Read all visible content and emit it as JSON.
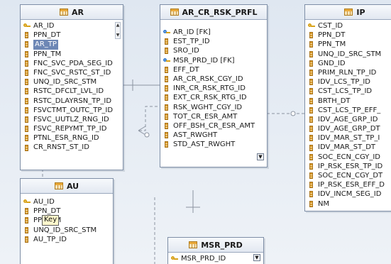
{
  "entities": {
    "ar": {
      "name": "AR",
      "columns": [
        {
          "label": "AR_ID",
          "kind": "pk"
        },
        {
          "label": "PPN_DT",
          "kind": "col"
        },
        {
          "label": "AR_TP",
          "kind": "col",
          "selected": true
        },
        {
          "label": "PPN_TM",
          "kind": "col"
        },
        {
          "label": "FNC_SVC_PDA_SEG_ID",
          "kind": "col"
        },
        {
          "label": "FNC_SVC_RSTC_ST_ID",
          "kind": "col"
        },
        {
          "label": "UNQ_ID_SRC_STM",
          "kind": "col"
        },
        {
          "label": "RSTC_DFCLT_LVL_ID",
          "kind": "col"
        },
        {
          "label": "RSTC_DLAYRSN_TP_ID",
          "kind": "col"
        },
        {
          "label": "FSVCTMT_OUTC_TP_ID",
          "kind": "col"
        },
        {
          "label": "FSVC_UUTLZ_RNG_ID",
          "kind": "col"
        },
        {
          "label": "FSVC_REPYMT_TP_ID",
          "kind": "col"
        },
        {
          "label": "PTNL_ESR_RNG_ID",
          "kind": "col"
        },
        {
          "label": "CR_RNST_ST_ID",
          "kind": "col"
        }
      ]
    },
    "ar_cr_rsk_prfl": {
      "name": "AR_CR_RSK_PRFL",
      "columns": [
        {
          "label": "AR_ID [FK]",
          "kind": "fk"
        },
        {
          "label": "EST_TP_ID",
          "kind": "col"
        },
        {
          "label": "SRO_ID",
          "kind": "col"
        },
        {
          "label": "MSR_PRD_ID [FK]",
          "kind": "fk"
        },
        {
          "label": "EFF_DT",
          "kind": "col"
        },
        {
          "label": "AR_CR_RSK_CGY_ID",
          "kind": "col"
        },
        {
          "label": "INR_CR_RSK_RTG_ID",
          "kind": "col"
        },
        {
          "label": "EXT_CR_RSK_RTG_ID",
          "kind": "col"
        },
        {
          "label": "RSK_WGHT_CGY_ID",
          "kind": "col"
        },
        {
          "label": "TOT_CR_ESR_AMT",
          "kind": "col"
        },
        {
          "label": "OFF_BSH_CR_ESR_AMT",
          "kind": "col"
        },
        {
          "label": "AST_RWGHT",
          "kind": "col"
        },
        {
          "label": "STD_AST_RWGHT",
          "kind": "col"
        }
      ]
    },
    "ip": {
      "name": "IP",
      "columns": [
        {
          "label": "CST_ID",
          "kind": "pk"
        },
        {
          "label": "PPN_DT",
          "kind": "col"
        },
        {
          "label": "PPN_TM",
          "kind": "col"
        },
        {
          "label": "UNQ_ID_SRC_STM",
          "kind": "col"
        },
        {
          "label": "GND_ID",
          "kind": "col"
        },
        {
          "label": "PRIM_RLN_TP_ID",
          "kind": "col"
        },
        {
          "label": "IDV_LCS_TP_ID",
          "kind": "col"
        },
        {
          "label": "CST_LCS_TP_ID",
          "kind": "col"
        },
        {
          "label": "BRTH_DT",
          "kind": "col"
        },
        {
          "label": "CST_LCS_TP_EFF_",
          "kind": "col"
        },
        {
          "label": "IDV_AGE_GRP_ID",
          "kind": "col"
        },
        {
          "label": "IDV_AGE_GRP_DT",
          "kind": "col"
        },
        {
          "label": "IDV_MAR_ST_TP_I",
          "kind": "col"
        },
        {
          "label": "IDV_MAR_ST_DT",
          "kind": "col"
        },
        {
          "label": "SOC_ECN_CGY_ID",
          "kind": "col"
        },
        {
          "label": "IP_RSK_ESR_TP_ID",
          "kind": "col"
        },
        {
          "label": "SOC_ECN_CGY_DT",
          "kind": "col"
        },
        {
          "label": "IP_RSK_ESR_EFF_D",
          "kind": "col"
        },
        {
          "label": "IDV_INCM_SEG_ID",
          "kind": "col"
        },
        {
          "label": "NM",
          "kind": "col"
        }
      ]
    },
    "au": {
      "name": "AU",
      "columns": [
        {
          "label": "AU_ID",
          "kind": "pk"
        },
        {
          "label": "PPN_DT",
          "kind": "col"
        },
        {
          "label": "PPN_TM",
          "kind": "col"
        },
        {
          "label": "UNQ_ID_SRC_STM",
          "kind": "col"
        },
        {
          "label": "AU_TP_ID",
          "kind": "col"
        }
      ],
      "tooltip": "Key"
    },
    "msr_prd": {
      "name": "MSR_PRD",
      "columns": [
        {
          "label": "MSR_PRD_ID",
          "kind": "pk"
        }
      ]
    }
  },
  "icons": {
    "table": "table-icon",
    "primary_key": "key-icon",
    "foreign_key": "foreign-key-icon",
    "column": "column-icon",
    "scroll_up": "scroll-up-arrow-icon",
    "scroll_down": "scroll-down-arrow-icon"
  },
  "colors": {
    "background": "#e3eaf3",
    "entity_border": "#7e8ea6",
    "selection": "#6d87b5",
    "connector": "#8b93a0"
  }
}
